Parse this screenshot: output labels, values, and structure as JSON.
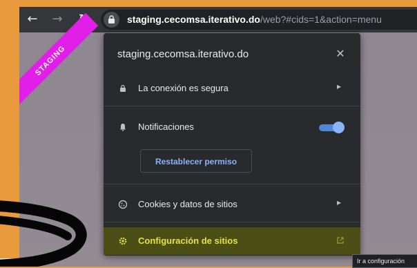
{
  "toolbar": {
    "back_icon": "arrow-left-icon",
    "forward_icon": "arrow-right-icon",
    "reload_icon": "reload-icon",
    "url_host": "staging.cecomsa.iterativo.do",
    "url_path": "/web?#cids=1&action=menu"
  },
  "page": {
    "ribbon": "STAGING"
  },
  "site_info": {
    "title": "staging.cecomsa.iterativo.do",
    "connection": "La conexión es segura",
    "notifications": "Notificaciones",
    "notifications_enabled": true,
    "reset_permission": "Restablecer permiso",
    "cookies": "Cookies y datos de sitios",
    "site_settings": "Configuración de sitios"
  },
  "tooltip": "Ir a configuración",
  "colors": {
    "accent": "#8ab4f8",
    "highlight": "#e4e14a",
    "ribbon": "#e21fe8",
    "background": "#e99a3c"
  }
}
